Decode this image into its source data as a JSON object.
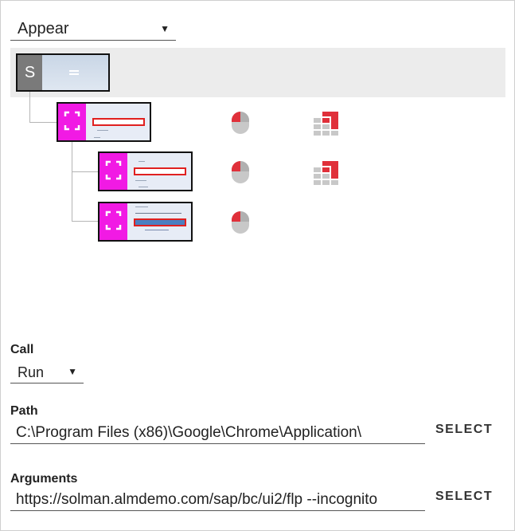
{
  "event_dropdown": {
    "value": "Appear"
  },
  "tree": {
    "root": {
      "badge": "S"
    }
  },
  "call": {
    "label": "Call",
    "value": "Run"
  },
  "path": {
    "label": "Path",
    "value": "C:\\Program Files (x86)\\Google\\Chrome\\Application\\",
    "select_label": "SELECT"
  },
  "arguments": {
    "label": "Arguments",
    "value": "https://solman.almdemo.com/sap/bc/ui2/flp --incognito",
    "select_label": "SELECT"
  },
  "icons": {
    "dropdown_caret": "caret-down-icon",
    "expand": "expand-frame-icon",
    "mouse": "mouse-click-icon",
    "grid": "element-grid-icon"
  },
  "colors": {
    "badge_magenta": "#f11ae4",
    "badge_gray": "#7a7a7a",
    "icon_red": "#e0303a",
    "icon_gray": "#c8c8c8",
    "highlight_red": "#e02020"
  }
}
